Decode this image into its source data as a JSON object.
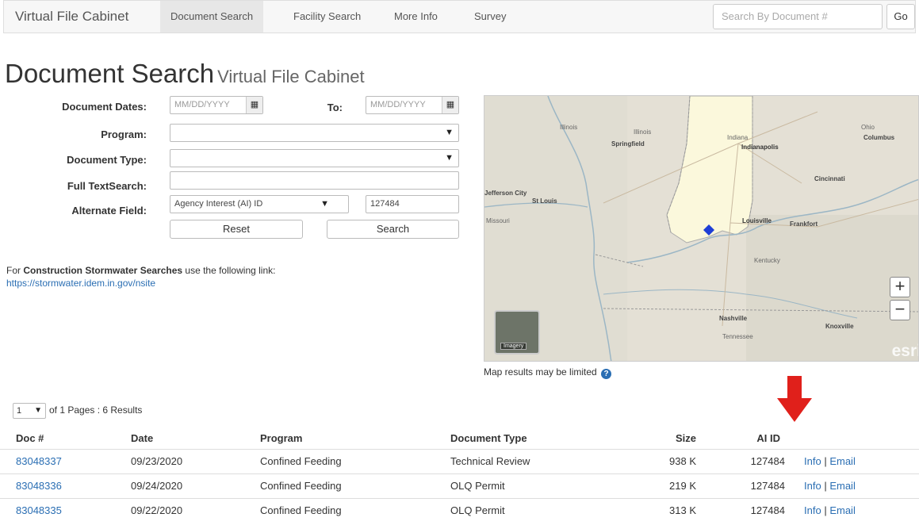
{
  "navbar": {
    "brand": "Virtual File Cabinet",
    "items": [
      {
        "label": "Document Search",
        "active": true
      },
      {
        "label": "Facility Search",
        "active": false
      },
      {
        "label": "More Info",
        "active": false
      },
      {
        "label": "Survey",
        "active": false
      }
    ],
    "search_placeholder": "Search By Document #",
    "go_label": "Go"
  },
  "page": {
    "title": "Document Search",
    "subtitle": "Virtual File Cabinet"
  },
  "form": {
    "document_dates_label": "Document Dates:",
    "date_placeholder": "MM/DD/YYYY",
    "to_label": "To:",
    "program_label": "Program:",
    "program_value": "",
    "document_type_label": "Document Type:",
    "document_type_value": "",
    "full_text_label": "Full TextSearch:",
    "full_text_value": "",
    "alternate_field_label": "Alternate Field:",
    "alternate_field_value": "Agency Interest (AI) ID",
    "alternate_value": "127484",
    "reset_label": "Reset",
    "search_label": "Search",
    "calendar_icon": "calendar-icon",
    "caret_icon": "chevron-down-icon"
  },
  "note": {
    "prefix": "For ",
    "bold": "Construction Stormwater Searches",
    "suffix": " use the following link:",
    "link": "https://stormwater.idem.in.gov/nsite"
  },
  "map": {
    "labels": [
      "Illinois",
      "Illinois",
      "Springfield",
      "Indiana",
      "Indianapolis",
      "Ohio",
      "Columbus",
      "Cincinnati",
      "Jefferson City",
      "St Louis",
      "Missouri",
      "Louisville",
      "Frankfort",
      "Kentucky",
      "Nashville",
      "Knoxville",
      "Tennessee"
    ],
    "zoom_in": "+",
    "zoom_out": "−",
    "basemap_label": "Imagery",
    "esri": "esri",
    "caption": "Map results may be limited",
    "highlight_color": "#fbf8dc",
    "marker_color": "#1f3fd6"
  },
  "results": {
    "page_value": "1",
    "pages_text": "of 1 Pages : 6 Results",
    "columns": [
      "Doc #",
      "Date",
      "Program",
      "Document Type",
      "Size",
      "AI ID"
    ],
    "rows": [
      {
        "doc": "83048337",
        "date": "09/23/2020",
        "program": "Confined Feeding",
        "type": "Technical Review",
        "size": "938 K",
        "ai": "127484",
        "info": "Info",
        "sep": "|",
        "email": "Email"
      },
      {
        "doc": "83048336",
        "date": "09/24/2020",
        "program": "Confined Feeding",
        "type": "OLQ Permit",
        "size": "219 K",
        "ai": "127484",
        "info": "Info",
        "sep": "|",
        "email": "Email"
      },
      {
        "doc": "83048335",
        "date": "09/22/2020",
        "program": "Confined Feeding",
        "type": "OLQ Permit",
        "size": "313 K",
        "ai": "127484",
        "info": "Info",
        "sep": "|",
        "email": "Email"
      }
    ]
  },
  "annotation": {
    "arrow_color": "#e0201b"
  }
}
